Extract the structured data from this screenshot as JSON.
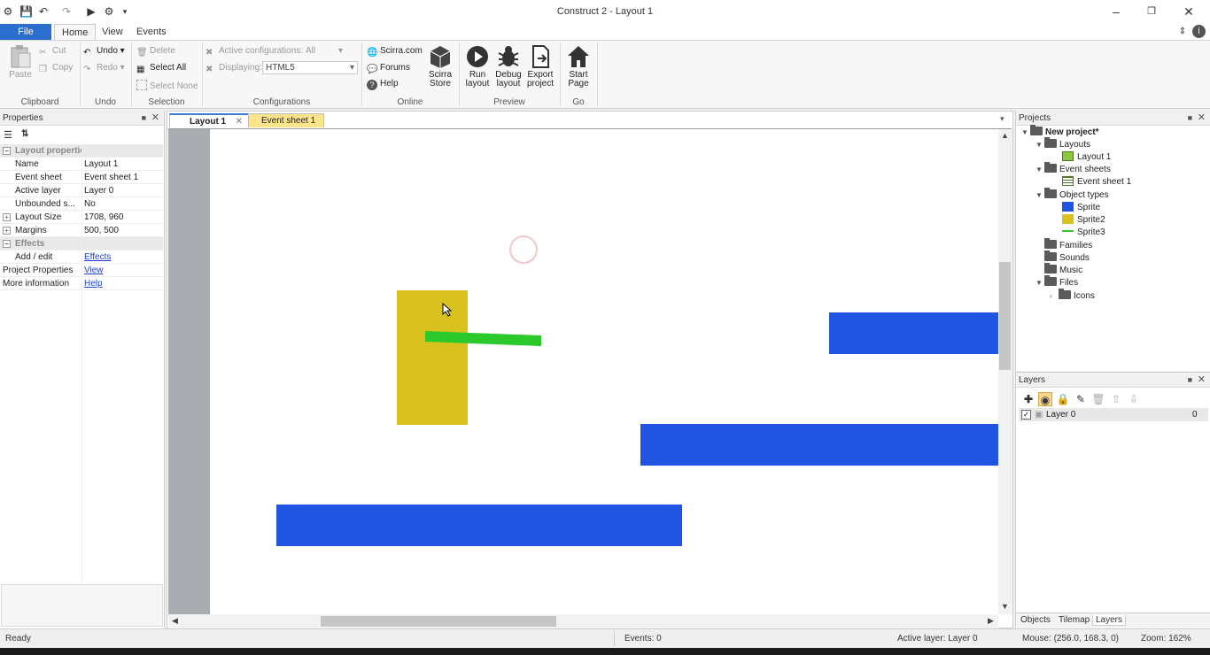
{
  "window": {
    "title": "Construct 2 - Layout 1"
  },
  "ribbon_tabs": [
    "File",
    "Home",
    "View",
    "Events"
  ],
  "ribbon": {
    "clipboard": {
      "paste": "Paste",
      "cut": "Cut",
      "copy": "Copy",
      "label": "Clipboard"
    },
    "undo": {
      "undo": "Undo",
      "redo": "Redo",
      "label": "Undo"
    },
    "selection": {
      "delete": "Delete",
      "select_all": "Select All",
      "select_none": "Select None",
      "label": "Selection"
    },
    "configurations": {
      "active_label": "Active configurations:",
      "active_value": "All",
      "displaying_label": "Displaying:",
      "displaying_value": "HTML5",
      "label": "Configurations"
    },
    "online": {
      "scirra": "Scirra.com",
      "forums": "Forums",
      "help": "Help",
      "store_line1": "Scirra",
      "store_line2": "Store",
      "label": "Online"
    },
    "preview": {
      "run_line1": "Run",
      "run_line2": "layout",
      "debug_line1": "Debug",
      "debug_line2": "layout",
      "export_line1": "Export",
      "export_line2": "project",
      "label": "Preview"
    },
    "go": {
      "start_line1": "Start",
      "start_line2": "Page",
      "label": "Go"
    }
  },
  "properties_panel": {
    "title": "Properties",
    "rows": [
      {
        "key": "Layout properties",
        "category": true
      },
      {
        "key": "Name",
        "value": "Layout 1"
      },
      {
        "key": "Event sheet",
        "value": "Event sheet 1"
      },
      {
        "key": "Active layer",
        "value": "Layer 0"
      },
      {
        "key": "Unbounded s...",
        "value": "No"
      },
      {
        "key": "Layout Size",
        "value": "1708, 960"
      },
      {
        "key": "Margins",
        "value": "500, 500"
      },
      {
        "key": "Effects",
        "category": true
      },
      {
        "key": "Add / edit",
        "value": "Effects"
      },
      {
        "key": "Project Properties",
        "value": "View"
      },
      {
        "key": "More information",
        "value": "Help"
      }
    ]
  },
  "editor": {
    "tabs": [
      "Layout 1",
      "Event sheet 1"
    ]
  },
  "projects_panel": {
    "title": "Projects",
    "root": "New project*",
    "layouts": "Layouts",
    "layout_1": "Layout 1",
    "event_sheets": "Event sheets",
    "event_sheet_1": "Event sheet 1",
    "object_types": "Object types",
    "objects": [
      {
        "name": "Sprite",
        "color": "#1f55e0"
      },
      {
        "name": "Sprite2",
        "color": "#d9c21f"
      },
      {
        "name": "Sprite3",
        "color": "#2bc92b"
      }
    ],
    "families": "Families",
    "sounds": "Sounds",
    "music": "Music",
    "files": "Files",
    "icons": "Icons"
  },
  "layers_panel": {
    "title": "Layers",
    "layer_name": "Layer 0",
    "layer_index": "0",
    "bottom_tabs": [
      "Objects",
      "Tilemap",
      "Layers"
    ]
  },
  "status": {
    "ready": "Ready",
    "events": "Events: 0",
    "active_layer": "Active layer: Layer 0",
    "mouse": "Mouse: (256.0, 168.3, 0)",
    "zoom": "Zoom: 162%"
  },
  "colors": {
    "accent": "#2b6fce",
    "sprite_blue": "#1f55e0",
    "sprite_yellow": "#d9c21f",
    "sprite_green": "#2bc92b"
  }
}
